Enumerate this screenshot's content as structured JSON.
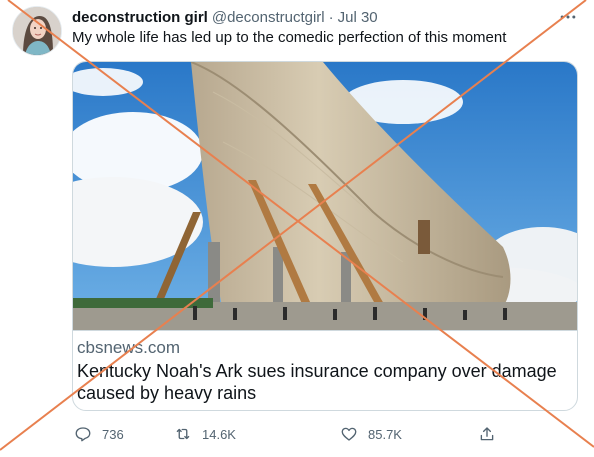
{
  "tweet": {
    "display_name": "deconstruction girl",
    "handle": "@deconstructgirl",
    "separator": "·",
    "date": "Jul 30",
    "text": "My whole life has led up to the comedic perfection of this moment"
  },
  "card": {
    "domain": "cbsnews.com",
    "title": "Kentucky Noah's Ark sues insurance company over damage caused by heavy rains"
  },
  "actions": {
    "replies": "736",
    "retweets": "14.6K",
    "likes": "85.7K"
  },
  "icons": {
    "more": "more-icon",
    "reply": "reply-icon",
    "retweet": "retweet-icon",
    "like": "heart-icon",
    "share": "share-icon"
  },
  "colors": {
    "text": "#0f1419",
    "secondary": "#536471",
    "border": "#cfd9de",
    "x_overlay": "#e8804f"
  }
}
